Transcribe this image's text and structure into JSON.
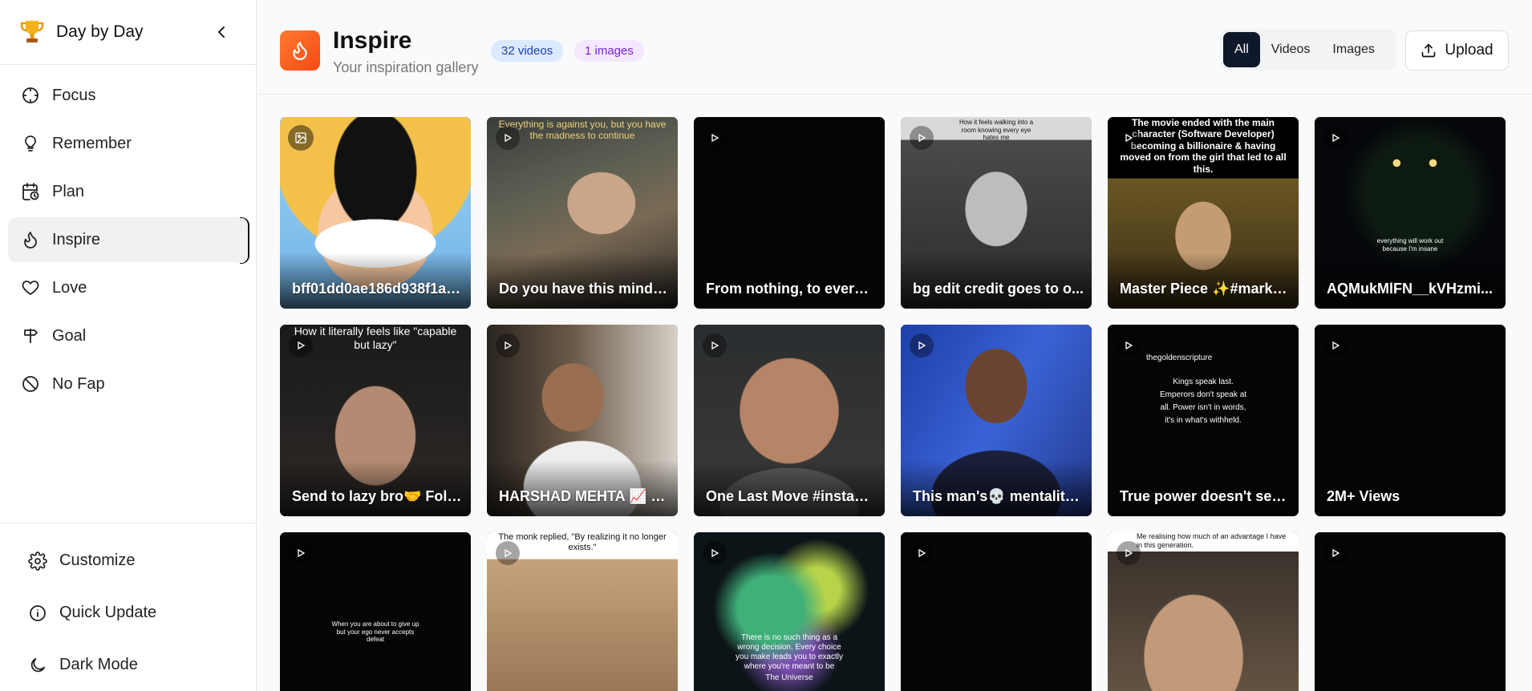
{
  "app": {
    "name": "Day by Day"
  },
  "sidebar": {
    "items": [
      {
        "label": "Focus",
        "icon": "crosshair-icon"
      },
      {
        "label": "Remember",
        "icon": "lightbulb-icon"
      },
      {
        "label": "Plan",
        "icon": "calendar-clock-icon"
      },
      {
        "label": "Inspire",
        "icon": "flame-icon",
        "active": true
      },
      {
        "label": "Love",
        "icon": "heart-icon"
      },
      {
        "label": "Goal",
        "icon": "signpost-icon"
      },
      {
        "label": "No Fap",
        "icon": "ban-icon"
      }
    ],
    "bottom": [
      {
        "label": "Customize",
        "icon": "gear-icon"
      },
      {
        "label": "Quick Update",
        "icon": "info-icon"
      },
      {
        "label": "Dark Mode",
        "icon": "moon-icon"
      }
    ]
  },
  "header": {
    "title": "Inspire",
    "subtitle": "Your inspiration gallery",
    "videos_badge": "32 videos",
    "images_badge": "1 images",
    "filters": [
      "All",
      "Videos",
      "Images"
    ],
    "active_filter": "All",
    "upload_label": "Upload"
  },
  "colors": {
    "accent": "#f44a17",
    "active_filter": "#0f172a"
  },
  "gallery": [
    {
      "type": "image",
      "caption": "bff01dd0ae186d938f1af8...",
      "overlay": ""
    },
    {
      "type": "video",
      "caption": "Do you have this minds...",
      "overlay": "Everything is against you, but you have the madness to continue"
    },
    {
      "type": "video",
      "caption": "From nothing, to everyt...",
      "overlay": ""
    },
    {
      "type": "video",
      "caption": "bg edit credit goes to o...",
      "overlay": "How it feels walking into a room knowing every eye hates me"
    },
    {
      "type": "video",
      "caption": "Master Piece ✨#markz...",
      "overlay": "The movie ended with the main character (Software Developer) becoming a billionaire & having moved on from the girl that led to all this."
    },
    {
      "type": "video",
      "caption": "AQMukMlFN__kVHzmi...",
      "overlay": "everything will work out because I'm insane"
    },
    {
      "type": "video",
      "caption": "Send to lazy bro🤝 Follo...",
      "overlay": "How it literally feels like \"capable but lazy\""
    },
    {
      "type": "video",
      "caption": "HARSHAD MEHTA 📈 O...",
      "overlay": ""
    },
    {
      "type": "video",
      "caption": "One Last Move #instago...",
      "overlay": ""
    },
    {
      "type": "video",
      "caption": "This man's💀 mentality ...",
      "overlay": ""
    },
    {
      "type": "video",
      "caption": "True power doesn't seek...",
      "overlay": "Kings speak last. Emperors don't speak at all. Power isn't in words, it's in what's withheld."
    },
    {
      "type": "video",
      "caption": "2M+ Views",
      "overlay": ""
    },
    {
      "type": "video",
      "caption": "",
      "overlay": "When you are about to give up but your ego never accepts defeat"
    },
    {
      "type": "video",
      "caption": "",
      "overlay": "The monk replied, \"By realizing it no longer exists.\""
    },
    {
      "type": "video",
      "caption": "",
      "overlay": "There is no such thing as a wrong decision. Every choice you make leads you to exactly where you're meant to be"
    },
    {
      "type": "video",
      "caption": "",
      "overlay": ""
    },
    {
      "type": "video",
      "caption": "",
      "overlay": "Me realising how much of an advantage I have in this generation."
    },
    {
      "type": "video",
      "caption": "",
      "overlay": ""
    }
  ],
  "gallery_extra": {
    "card10_handle": "thegoldenscripture",
    "card15_sign": "The Universe"
  }
}
